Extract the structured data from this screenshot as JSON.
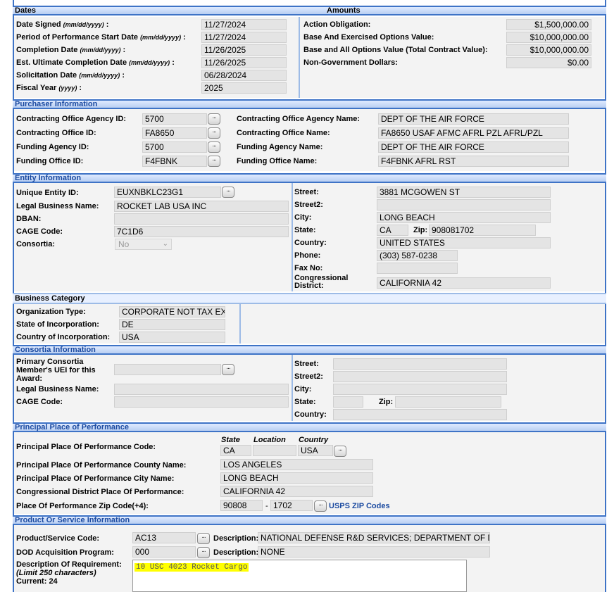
{
  "dates": {
    "header": "Dates",
    "date_signed": {
      "label": "Date Signed",
      "fmt": "(mm/dd/yyyy)",
      "value": "11/27/2024"
    },
    "pop_start": {
      "label": "Period of Performance Start Date",
      "fmt": "(mm/dd/yyyy)",
      "value": "11/27/2024"
    },
    "completion": {
      "label": "Completion Date",
      "fmt": "(mm/dd/yyyy)",
      "value": "11/26/2025"
    },
    "est_ultimate": {
      "label": "Est. Ultimate Completion Date",
      "fmt": "(mm/dd/yyyy)",
      "value": "11/26/2025"
    },
    "solicitation": {
      "label": "Solicitation Date",
      "fmt": "(mm/dd/yyyy)",
      "value": "06/28/2024"
    },
    "fiscal_year": {
      "label": "Fiscal Year",
      "fmt": "(yyyy)",
      "value": "2025"
    }
  },
  "amounts": {
    "header": "Amounts",
    "action_obligation": {
      "label": "Action Obligation:",
      "value": "$1,500,000.00"
    },
    "base_exercised": {
      "label": "Base And Exercised Options Value:",
      "value": "$10,000,000.00"
    },
    "base_all": {
      "label": "Base and All Options Value (Total Contract Value):",
      "value": "$10,000,000.00"
    },
    "non_gov": {
      "label": "Non-Government Dollars:",
      "value": "$0.00"
    }
  },
  "purchaser": {
    "header": "Purchaser Information",
    "co_agency_id": {
      "label": "Contracting Office Agency ID:",
      "value": "5700"
    },
    "co_id": {
      "label": "Contracting Office ID:",
      "value": "FA8650"
    },
    "funding_agency_id": {
      "label": "Funding Agency ID:",
      "value": "5700"
    },
    "funding_office_id": {
      "label": "Funding Office ID:",
      "value": "F4FBNK"
    },
    "co_agency_name": {
      "label": "Contracting Office Agency Name:",
      "value": "DEPT OF THE AIR FORCE"
    },
    "co_name": {
      "label": "Contracting Office Name:",
      "value": "FA8650  USAF AFMC AFRL PZL AFRL/PZL"
    },
    "funding_agency_name": {
      "label": "Funding Agency Name:",
      "value": "DEPT OF THE AIR FORCE"
    },
    "funding_office_name": {
      "label": "Funding Office Name:",
      "value": "F4FBNK AFRL RST"
    }
  },
  "entity": {
    "header": "Entity Information",
    "uei": {
      "label": "Unique Entity ID:",
      "value": "EUXNBKLC23G1"
    },
    "legal_name": {
      "label": "Legal Business Name:",
      "value": "ROCKET LAB USA INC"
    },
    "dban": {
      "label": "DBAN:",
      "value": ""
    },
    "cage": {
      "label": "CAGE Code:",
      "value": "7C1D6"
    },
    "consortia": {
      "label": "Consortia:",
      "value": "No"
    },
    "street": {
      "label": "Street:",
      "value": "3881 MCGOWEN ST"
    },
    "street2": {
      "label": "Street2:",
      "value": ""
    },
    "city": {
      "label": "City:",
      "value": "LONG BEACH"
    },
    "state": {
      "label": "State:",
      "value": "CA"
    },
    "zip": {
      "label": "Zip:",
      "value": "908081702"
    },
    "country": {
      "label": "Country:",
      "value": "UNITED STATES"
    },
    "phone": {
      "label": "Phone:",
      "value": "(303) 587-0238"
    },
    "fax": {
      "label": "Fax No:",
      "value": ""
    },
    "cong_district": {
      "label1": "Congressional",
      "label2": "District:",
      "value": "CALIFORNIA 42"
    }
  },
  "business": {
    "header": "Business Category",
    "org_type": {
      "label": "Organization Type:",
      "value": "CORPORATE NOT TAX EXEMPT"
    },
    "state_inc": {
      "label": "State of Incorporation:",
      "value": "DE"
    },
    "country_inc": {
      "label": "Country of Incorporation:",
      "value": "USA"
    }
  },
  "consortia_info": {
    "header": "Consortia Information",
    "primary_uei": {
      "label1": "Primary Consortia",
      "label2": "Member's UEI for this",
      "label3": "Award:",
      "value": ""
    },
    "legal_name": {
      "label": "Legal Business Name:",
      "value": ""
    },
    "cage": {
      "label": "CAGE Code:",
      "value": ""
    },
    "street": {
      "label": "Street:",
      "value": ""
    },
    "street2": {
      "label": "Street2:",
      "value": ""
    },
    "city": {
      "label": "City:",
      "value": ""
    },
    "state": {
      "label": "State:",
      "value": ""
    },
    "zip": {
      "label": "Zip:",
      "value": ""
    },
    "country": {
      "label": "Country:",
      "value": ""
    }
  },
  "pop": {
    "header": "Principal Place of Performance",
    "col_state": "State",
    "col_location": "Location",
    "col_country": "Country",
    "code": {
      "label": "Principal Place Of Performance Code:",
      "state": "CA",
      "location": "",
      "country": "USA"
    },
    "county": {
      "label": "Principal Place Of Performance County Name:",
      "value": "LOS ANGELES"
    },
    "city": {
      "label": "Principal Place Of Performance City Name:",
      "value": "LONG BEACH"
    },
    "cong": {
      "label": "Congressional District Place Of Performance:",
      "value": "CALIFORNIA 42"
    },
    "zip": {
      "label": "Place Of Performance Zip Code(+4):",
      "zip5": "90808",
      "sep": "-",
      "zip4": "1702"
    },
    "usps_link": "USPS ZIP Codes"
  },
  "product": {
    "header": "Product Or Service Information",
    "psc": {
      "label": "Product/Service Code:",
      "value": "AC13",
      "desc_label": "Description:",
      "desc": "NATIONAL DEFENSE R&D SERVICES; DEPARTMENT OF DEFENSE"
    },
    "dod_program": {
      "label": "DOD Acquisition Program:",
      "value": "000",
      "desc_label": "Description:",
      "desc": "NONE"
    },
    "req": {
      "label1": "Description Of Requirement:",
      "label2": "(Limit 250 characters)",
      "label3": "Current: 24",
      "value": "10 USC 4023 Rocket Cargo"
    }
  },
  "icons": {
    "lookup": "ellipsis-lookup-icon",
    "dropdown": "chevron-down-icon"
  },
  "colors": {
    "section_border": "#3e73c6",
    "header_text": "#1b4aa0",
    "field_bg": "#e4e4e4",
    "highlight": "#ffff00"
  }
}
